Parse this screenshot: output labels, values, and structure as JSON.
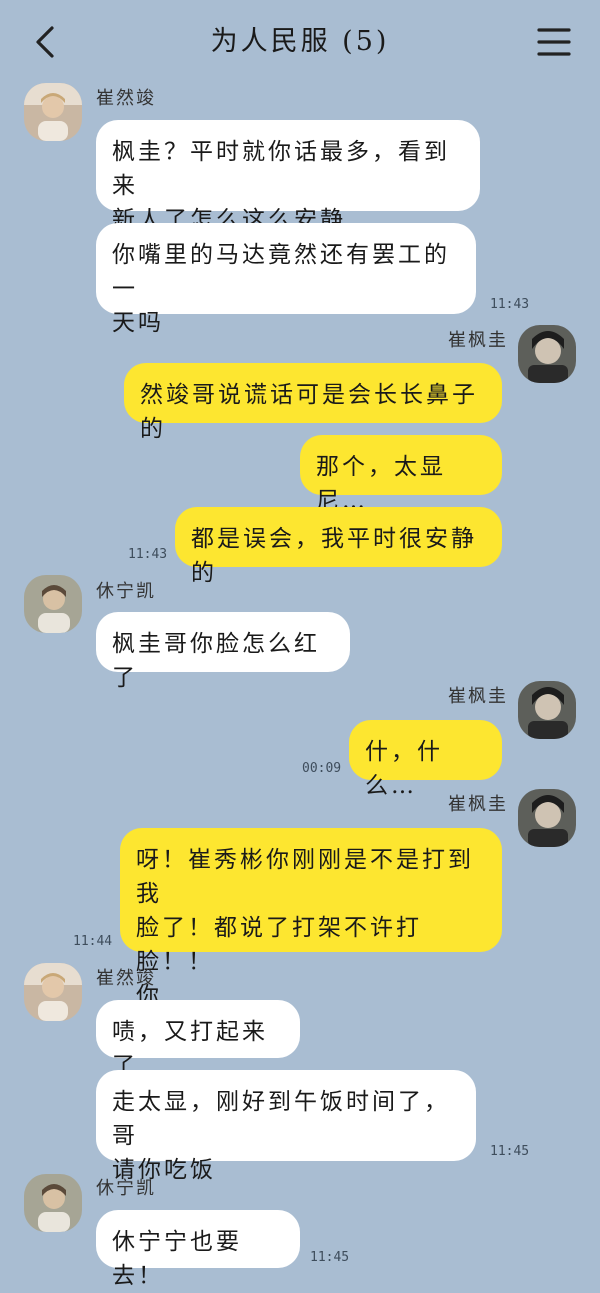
{
  "header": {
    "title": "为人民服 (5)",
    "back_icon": "chevron-left-icon",
    "menu_icon": "hamburger-menu-icon"
  },
  "colors": {
    "background": "#a9bdd2",
    "incoming_bubble": "#ffffff",
    "outgoing_bubble": "#fde630"
  },
  "messages": {
    "g1": {
      "sender": "崔然竣",
      "m1": "枫圭？平时就你话最多，看到来\n新人了怎么这么安静",
      "m2": "你嘴里的马达竟然还有罢工的一\n天吗",
      "time": "11:43"
    },
    "g2": {
      "sender": "崔枫圭",
      "m1": "然竣哥说谎话可是会长长鼻子的",
      "m2": "那个，太显尼…",
      "m3": "都是误会，我平时很安静的",
      "time": "11:43"
    },
    "g3": {
      "sender": "休宁凯",
      "m1": "枫圭哥你脸怎么红了"
    },
    "g4": {
      "sender": "崔枫圭",
      "m1": "什，什么…",
      "time": "00:09"
    },
    "g5": {
      "sender": "崔枫圭",
      "m1": "呀！崔秀彬你刚刚是不是打到我\n脸了！都说了打架不许打脸！！\n你……",
      "time": "11:44"
    },
    "g6": {
      "sender": "崔然竣",
      "m1": "啧，又打起来了",
      "m2": "走太显，刚好到午饭时间了，哥\n请你吃饭",
      "time": "11:45"
    },
    "g7": {
      "sender": "休宁凯",
      "m1": "休宁宁也要去！",
      "time": "11:45"
    }
  }
}
